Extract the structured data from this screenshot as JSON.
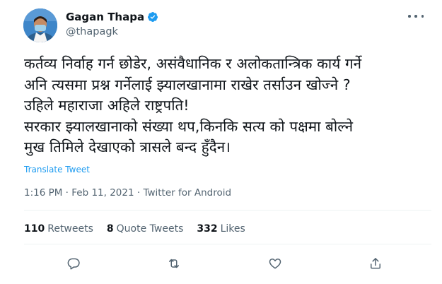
{
  "author": {
    "name": "Gagan Thapa",
    "handle": "@thapagk"
  },
  "tweet": {
    "text": "कर्तव्य निर्वाह गर्न छोडेर, असंवैधानिक र अलोकतान्त्रिक कार्य गर्ने\nअनि त्यसमा प्रश्न गर्नेलाई झ्यालखानामा राखेर तर्साउन खोज्ने ?\nउहिले महाराजा अहिले राष्ट्रपति!\nसरकार झ्यालखानाको संख्या थप,किनकि सत्य को पक्षमा बोल्ने\nमुख तिमिले देखाएको त्रासले बन्द हुँदैन।",
    "translate_label": "Translate Tweet",
    "meta": "1:16 PM · Feb 11, 2021 · Twitter for Android"
  },
  "stats": {
    "retweets_count": "110",
    "retweets_label": "Retweets",
    "quotes_count": "8",
    "quotes_label": "Quote Tweets",
    "likes_count": "332",
    "likes_label": "Likes"
  },
  "colors": {
    "accent": "#1d9bf0",
    "secondary_text": "#536471",
    "divider": "#eff3f4"
  },
  "icons": {
    "verified": "verified-badge-icon",
    "more": "more-options-icon",
    "reply": "reply-icon",
    "retweet": "retweet-icon",
    "like": "heart-icon",
    "share": "share-icon"
  }
}
